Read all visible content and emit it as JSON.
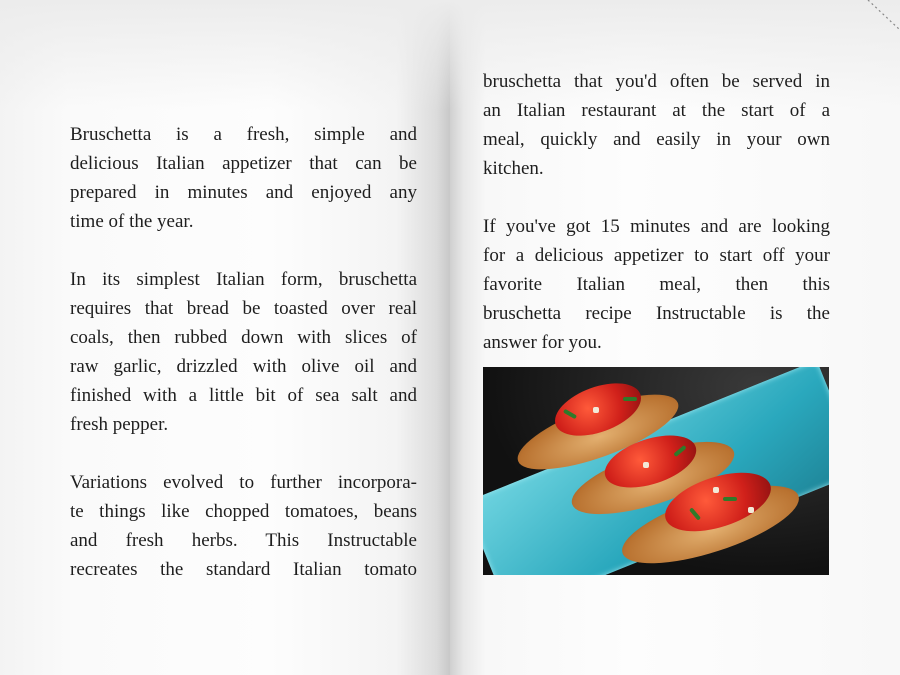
{
  "left_page": {
    "paragraphs": [
      [
        "Bruschetta is a fresh, simple and",
        "delicious Italian appetizer that can be",
        "prepared in minutes and enjoyed any",
        "time of the year."
      ],
      [
        "In its simplest Italian form, bruschetta",
        "requires that bread be toasted over real",
        "coals, then rubbed down with slices of",
        "raw garlic, drizzled with olive oil and",
        "finished with a little bit of sea salt and",
        "fresh pepper."
      ],
      [
        "Variations evolved to further incorpora-",
        "te things like chopped tomatoes, beans",
        "and fresh herbs.  This Instructable",
        "recreates the standard Italian tomato"
      ]
    ]
  },
  "right_page": {
    "paragraphs": [
      [
        "bruschetta that you'd often be served in",
        "an Italian restaurant at the start of a",
        "meal, quickly and easily in your own",
        "kitchen."
      ],
      [
        "If you've got 15 minutes and are looking",
        "for a delicious appetizer to start off your",
        "favorite Italian meal, then this",
        "bruschetta recipe Instructable is the",
        "answer for you."
      ]
    ],
    "image_subject": "bruschetta on turquoise plate"
  },
  "page_curl_icon": "dog-ear-corner"
}
